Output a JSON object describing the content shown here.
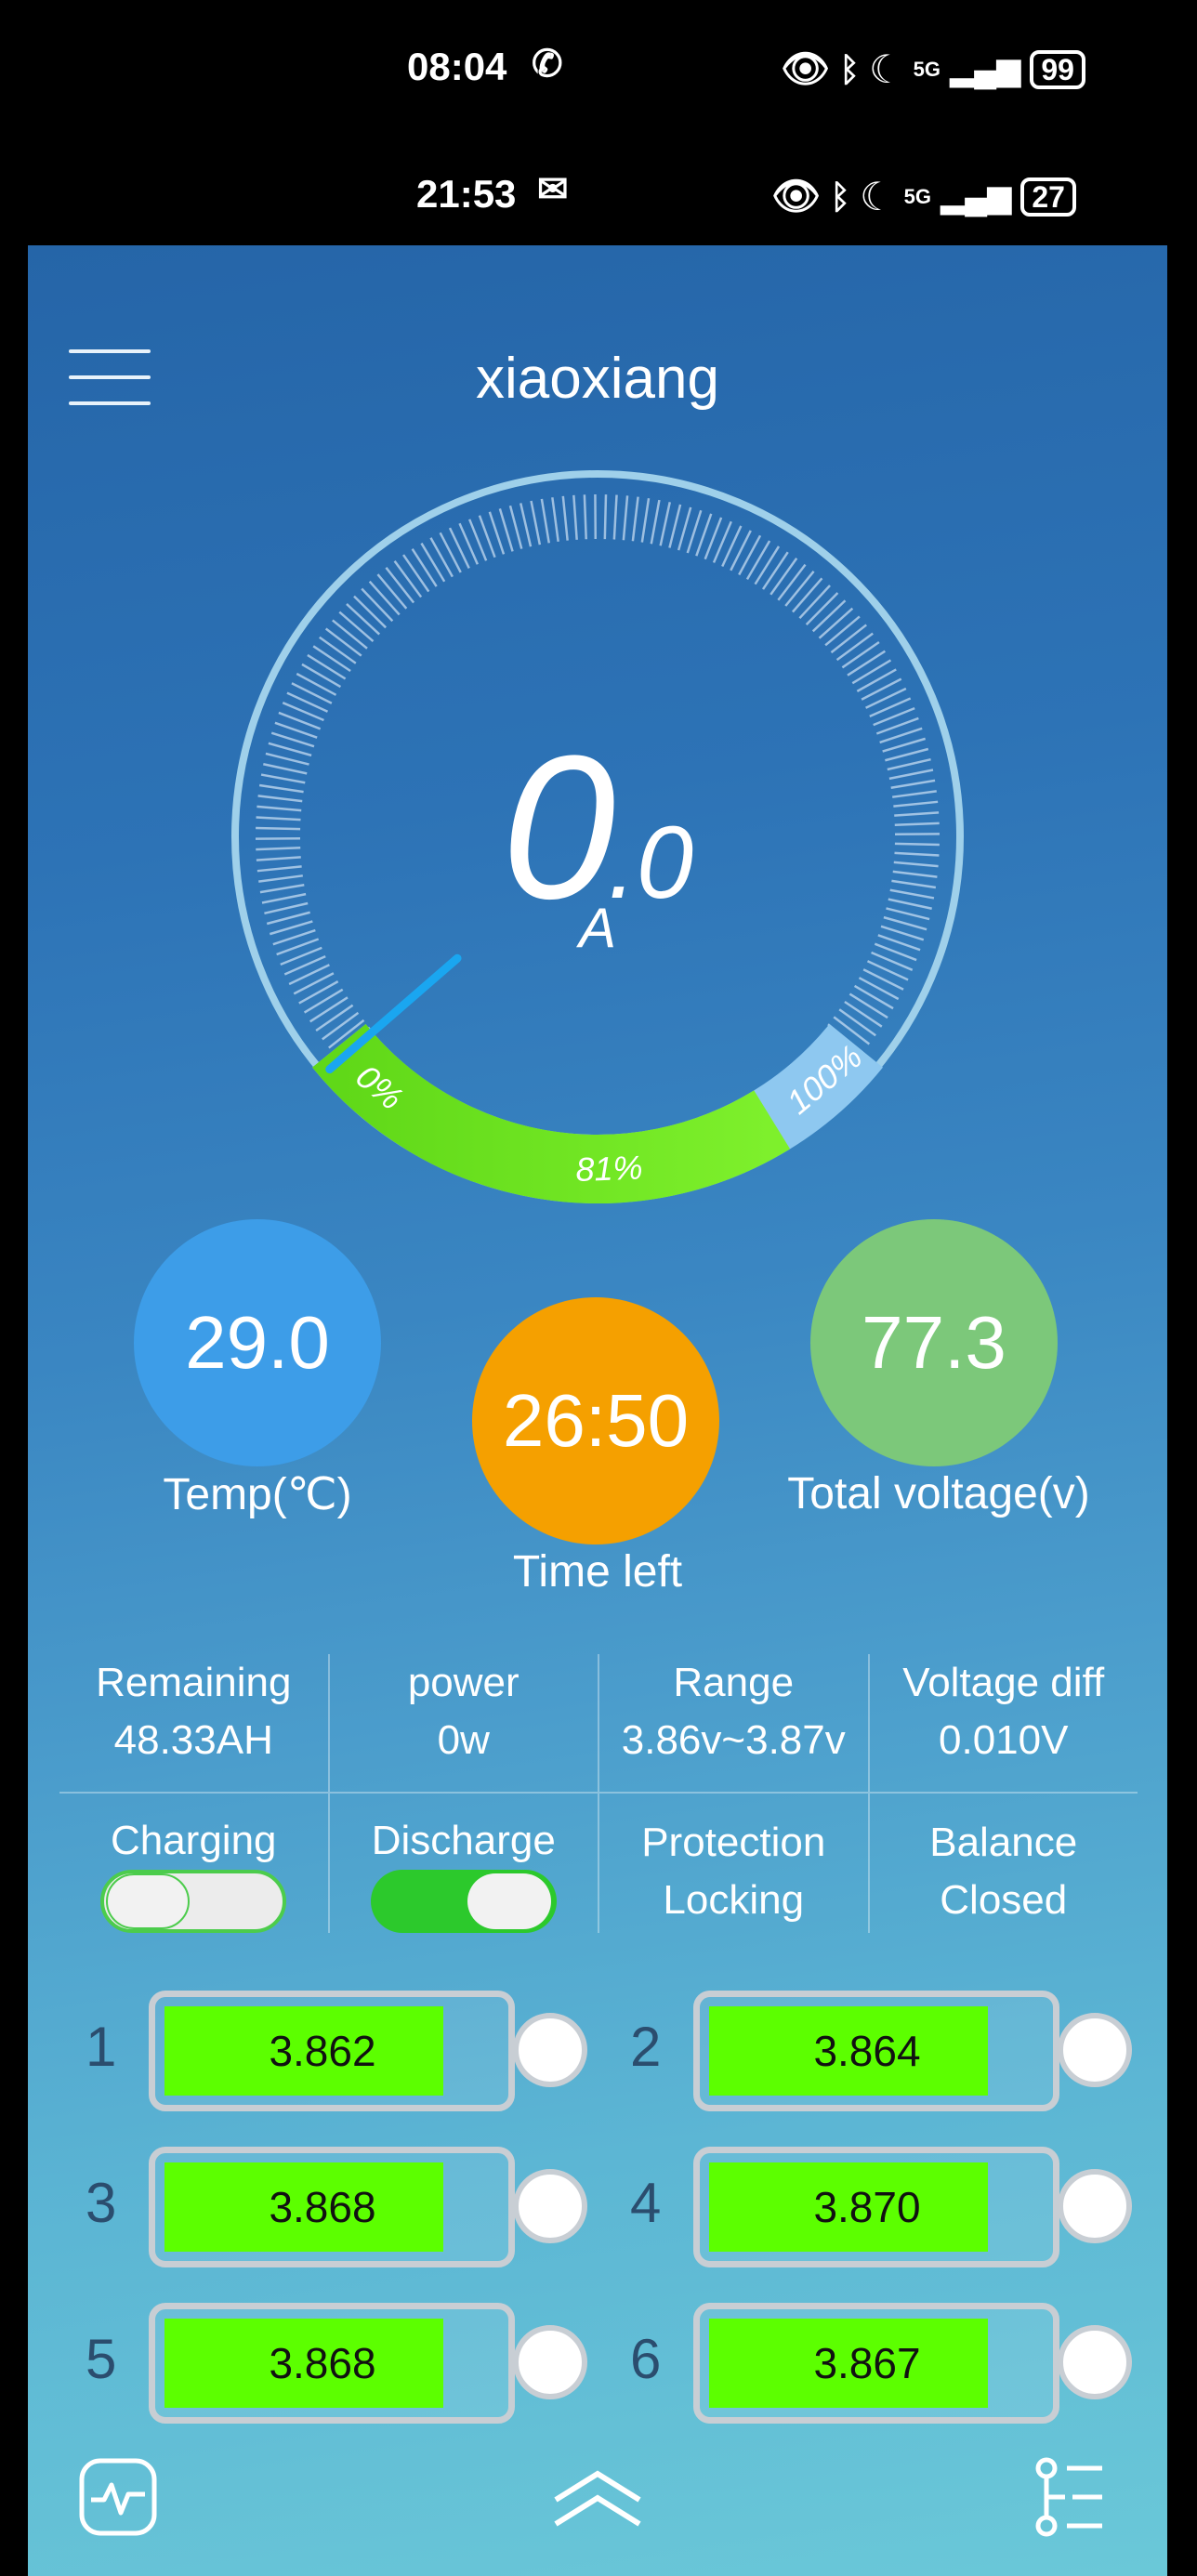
{
  "status_bar_outer": {
    "time": "08:04",
    "network": "5G",
    "battery": "99"
  },
  "status_bar_inner": {
    "time": "21:53",
    "network": "5G",
    "battery": "27"
  },
  "app": {
    "title": "xiaoxiang"
  },
  "gauge": {
    "current_int": "0",
    "current_dec": ".0",
    "unit": "A",
    "soc_start_label": "0%",
    "soc_label": "81%",
    "soc_end_label": "100%",
    "soc_percent": 81
  },
  "circles": {
    "temp_value": "29.0",
    "temp_label": "Temp(℃)",
    "time_value": "26:50",
    "time_label": "Time left",
    "volt_value": "77.3",
    "volt_label": "Total voltage(v)"
  },
  "stats": {
    "remaining_label": "Remaining",
    "remaining_value": "48.33AH",
    "power_label": "power",
    "power_value": "0w",
    "range_label": "Range",
    "range_value": "3.86v~3.87v",
    "vdiff_label": "Voltage diff",
    "vdiff_value": "0.010V",
    "charging_label": "Charging",
    "charging_on": false,
    "discharge_label": "Discharge",
    "discharge_on": true,
    "protection_label": "Protection",
    "protection_value": "Locking",
    "balance_label": "Balance",
    "balance_value": "Closed"
  },
  "cells": [
    {
      "index": "1",
      "voltage": "3.862"
    },
    {
      "index": "2",
      "voltage": "3.864"
    },
    {
      "index": "3",
      "voltage": "3.868"
    },
    {
      "index": "4",
      "voltage": "3.870"
    },
    {
      "index": "5",
      "voltage": "3.868"
    },
    {
      "index": "6",
      "voltage": "3.867"
    }
  ],
  "colors": {
    "cell_fill": "#5cff00",
    "temp_circle": "#3d9de8",
    "time_circle": "#f5a000",
    "volt_circle": "#7cc87a",
    "soc_arc": "#6fe020"
  },
  "icons": {
    "bottom_left": "activity-monitor-icon",
    "bottom_center": "double-chevron-up-icon",
    "bottom_right": "timeline-list-icon"
  }
}
